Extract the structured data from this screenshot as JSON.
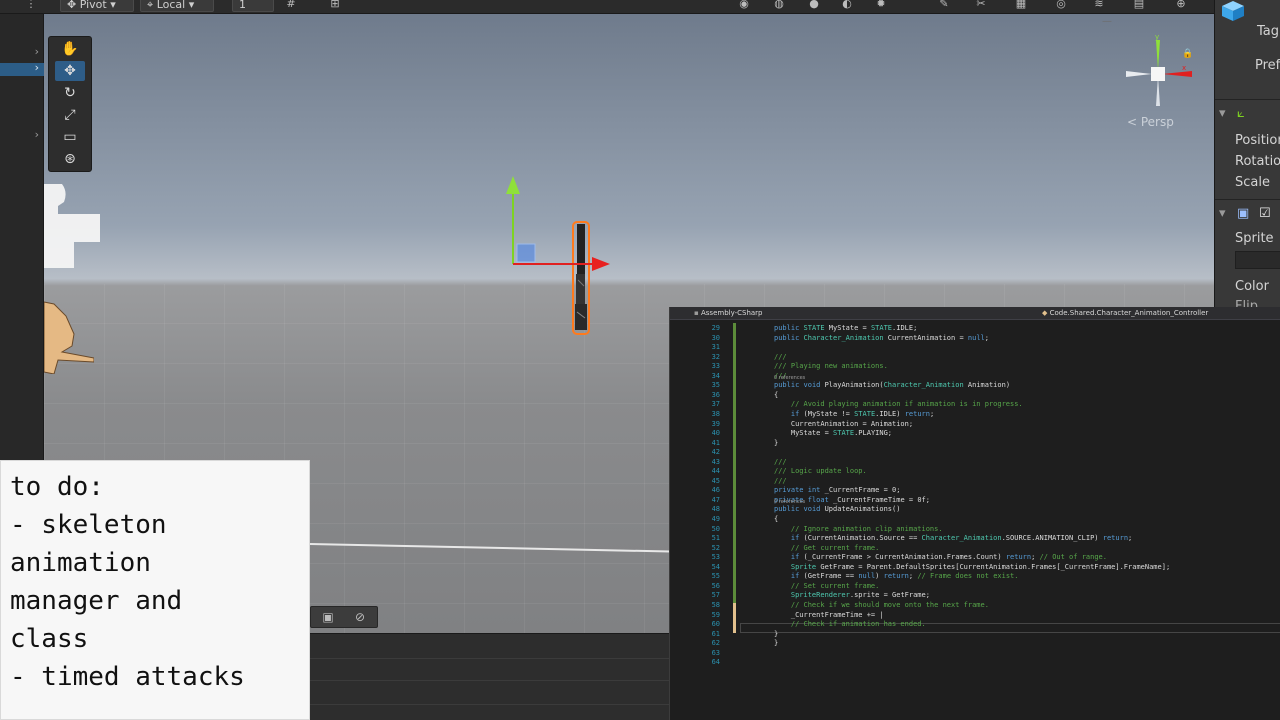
{
  "toolbar": {
    "pivot": "Pivot",
    "local": "Local",
    "snap_value": "1"
  },
  "scene": {
    "persp_label": "< Persp"
  },
  "todo": {
    "lines": [
      "to do:",
      "- skeleton",
      "animation",
      "manager and",
      "class",
      "- timed attacks"
    ]
  },
  "inspector": {
    "tag": "Tag",
    "prefab": "Prefab",
    "position": "Position",
    "rotation": "Rotation",
    "scale": "Scale",
    "sprite": "Sprite",
    "color": "Color",
    "flip": "Flip"
  },
  "editor": {
    "project": "Assembly-CSharp",
    "class_path": "Code.Shared.Character_Animation_Controller",
    "refs_label": "0 references",
    "lines": [
      {
        "n": "29",
        "code": "public STATE MyState = STATE.IDLE;"
      },
      {
        "n": "30",
        "code": "public Character_Animation CurrentAnimation = null;"
      },
      {
        "n": "31",
        "code": ""
      },
      {
        "n": "32",
        "code": "///"
      },
      {
        "n": "33",
        "code": "/// Playing new animations."
      },
      {
        "n": "34",
        "code": "///"
      },
      {
        "n": "35",
        "code": "public void PlayAnimation(Character_Animation Animation)"
      },
      {
        "n": "36",
        "code": "{"
      },
      {
        "n": "37",
        "code": "    // Avoid playing animation if animation is in progress."
      },
      {
        "n": "38",
        "code": "    if (MyState != STATE.IDLE) return;"
      },
      {
        "n": "39",
        "code": "    CurrentAnimation = Animation;"
      },
      {
        "n": "40",
        "code": "    MyState = STATE.PLAYING;"
      },
      {
        "n": "41",
        "code": "}"
      },
      {
        "n": "42",
        "code": ""
      },
      {
        "n": "43",
        "code": "///"
      },
      {
        "n": "44",
        "code": "/// Logic update loop."
      },
      {
        "n": "45",
        "code": "///"
      },
      {
        "n": "46",
        "code": "private int _CurrentFrame = 0;"
      },
      {
        "n": "47",
        "code": "private float _CurrentFrameTime = 0f;"
      },
      {
        "n": "48",
        "code": "public void UpdateAnimations()"
      },
      {
        "n": "49",
        "code": "{"
      },
      {
        "n": "50",
        "code": "    // Ignore animation clip animations."
      },
      {
        "n": "51",
        "code": "    if (CurrentAnimation.Source == Character_Animation.SOURCE.ANIMATION_CLIP) return;"
      },
      {
        "n": "52",
        "code": "    // Get current frame."
      },
      {
        "n": "53",
        "code": "    if (_CurrentFrame > CurrentAnimation.Frames.Count) return; // Out of range."
      },
      {
        "n": "54",
        "code": "    Sprite GetFrame = Parent.DefaultSprites[CurrentAnimation.Frames[_CurrentFrame].FrameName];"
      },
      {
        "n": "55",
        "code": "    if (GetFrame == null) return; // Frame does not exist."
      },
      {
        "n": "56",
        "code": "    // Set current frame."
      },
      {
        "n": "57",
        "code": "    SpriteRenderer.sprite = GetFrame;"
      },
      {
        "n": "58",
        "code": "    // Check if we should move onto the next frame."
      },
      {
        "n": "59",
        "code": "    _CurrentFrameTime += |"
      },
      {
        "n": "60",
        "code": "    // Check if animation has ended."
      },
      {
        "n": "61",
        "code": "}"
      },
      {
        "n": "62",
        "code": "}"
      },
      {
        "n": "63",
        "code": ""
      },
      {
        "n": "64",
        "code": ""
      }
    ]
  }
}
